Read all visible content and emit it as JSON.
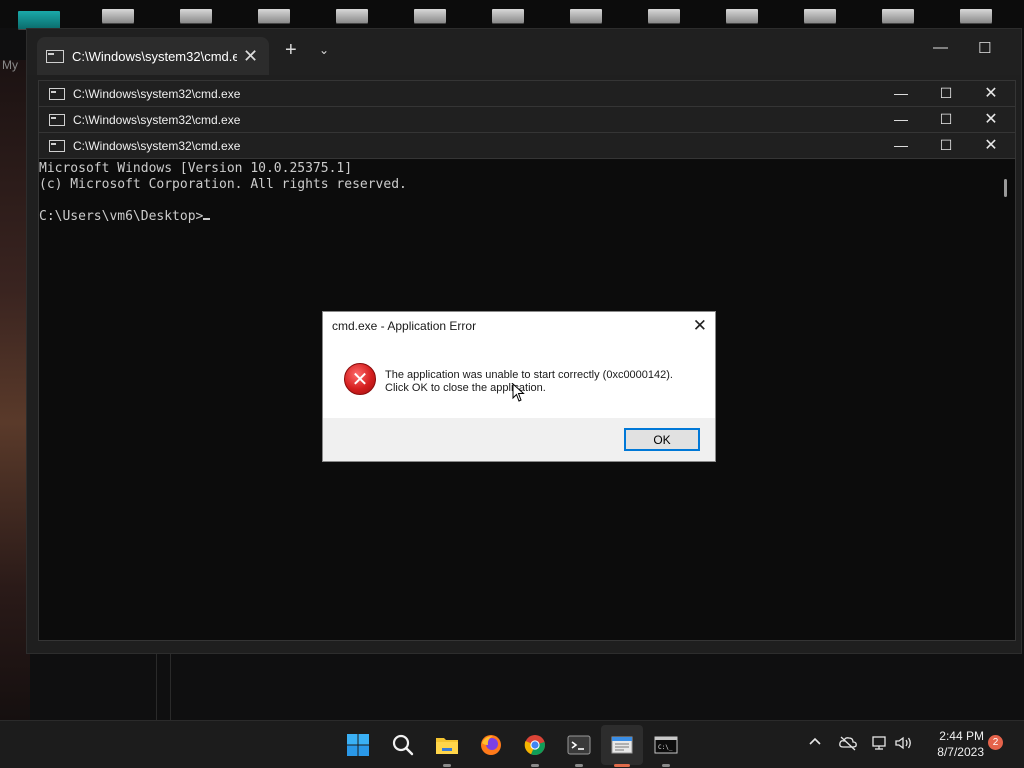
{
  "desktop": {
    "label_fragment": "My"
  },
  "host_window": {
    "tab_title": "C:\\Windows\\system32\\cmd.e:",
    "tab_close_glyph": "✕",
    "add_tab_glyph": "+",
    "dropdown_glyph": "⌄",
    "minimize_glyph": "—",
    "maximize_glyph": "☐"
  },
  "cmd_windows": [
    {
      "title": "C:\\Windows\\system32\\cmd.exe"
    },
    {
      "title": "C:\\Windows\\system32\\cmd.exe"
    },
    {
      "title": "C:\\Windows\\system32\\cmd.exe"
    }
  ],
  "window_controls": {
    "minimize": "—",
    "maximize": "☐",
    "close": "✕"
  },
  "console": {
    "line1": "Microsoft Windows [Version 10.0.25375.1]",
    "line2": "(c) Microsoft Corporation. All rights reserved.",
    "prompt": "C:\\Users\\vm6\\Desktop>"
  },
  "dialog": {
    "title": "cmd.exe - Application Error",
    "close_glyph": "✕",
    "icon_glyph": "✕",
    "message_line1": "The application was unable to start correctly (0xc0000142).",
    "message_line2": "Click OK to close the application.",
    "ok_label": "OK"
  },
  "taskbar": {
    "apps": [
      {
        "name": "start-button",
        "icon": "windows-logo"
      },
      {
        "name": "search-button",
        "icon": "search-icon"
      },
      {
        "name": "file-explorer",
        "icon": "folder-icon"
      },
      {
        "name": "firefox",
        "icon": "firefox-icon"
      },
      {
        "name": "chrome",
        "icon": "chrome-icon"
      },
      {
        "name": "terminal",
        "icon": "terminal-icon"
      },
      {
        "name": "notepad",
        "icon": "notepad-icon"
      },
      {
        "name": "cmd",
        "icon": "cmd-icon"
      }
    ],
    "tray": {
      "chevron": "^",
      "time": "2:44 PM",
      "date": "8/7/2023",
      "notification_count": "2"
    }
  },
  "colors": {
    "taskbar_accent": "#e06a4a",
    "error_red": "#d41f1f",
    "ok_border": "#0078d7",
    "console_bg": "#0c0c0c",
    "console_text": "#cccccc"
  }
}
